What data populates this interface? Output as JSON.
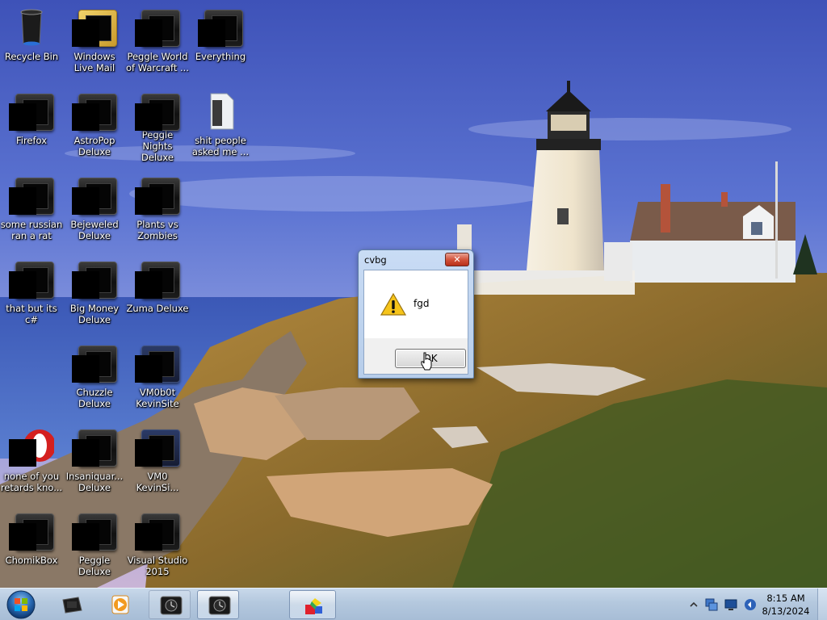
{
  "desktop": {
    "icons": [
      {
        "label": "Recycle Bin",
        "icon": "recycle-bin-icon"
      },
      {
        "label": "Windows Live Mail",
        "icon": "windows-live-mail-icon"
      },
      {
        "label": "Peggle World of Warcraft ...",
        "icon": "peggle-world-of-warcraft-icon"
      },
      {
        "label": "Everything",
        "icon": "everything-icon"
      },
      {
        "label": "Firefox",
        "icon": "firefox-icon"
      },
      {
        "label": "AstroPop Deluxe",
        "icon": "astropop-deluxe-icon"
      },
      {
        "label": "Peggle Nights Deluxe",
        "icon": "peggle-nights-deluxe-icon"
      },
      {
        "label": "shit people asked me ...",
        "icon": "file-icon"
      },
      {
        "label": "some russian ran a rat",
        "icon": "app-icon"
      },
      {
        "label": "Bejeweled Deluxe",
        "icon": "bejeweled-deluxe-icon"
      },
      {
        "label": "Plants vs Zombies",
        "icon": "plants-vs-zombies-icon"
      },
      {
        "label": "that but its c#",
        "icon": "app-icon"
      },
      {
        "label": "Big Money Deluxe",
        "icon": "big-money-deluxe-icon"
      },
      {
        "label": "Zuma Deluxe",
        "icon": "zuma-deluxe-icon"
      },
      {
        "label": "Chuzzle Deluxe",
        "icon": "chuzzle-deluxe-icon"
      },
      {
        "label": "VM0b0t KevinSite",
        "icon": "vm0b0t-icon"
      },
      {
        "label": "none of you retards kno...",
        "icon": "opera-icon"
      },
      {
        "label": "Insaniquar... Deluxe",
        "icon": "insaniquarium-deluxe-icon"
      },
      {
        "label": "VM0 KevinSi...",
        "icon": "vm0-icon"
      },
      {
        "label": "ChomikBox",
        "icon": "chomikbox-icon"
      },
      {
        "label": "Peggle Deluxe",
        "icon": "peggle-deluxe-icon"
      },
      {
        "label": "Visual Studio 2015",
        "icon": "visual-studio-icon"
      }
    ]
  },
  "dialog": {
    "title": "cvbg",
    "close_symbol": "✕",
    "message": "fgd",
    "icon": "warning-icon",
    "ok_label": "OK"
  },
  "taskbar": {
    "start": "windows-start-icon",
    "pinned": [
      "camera-app-icon",
      "media-player-icon",
      "clock-app-icon",
      "clock-app-icon",
      "cube-app-icon"
    ],
    "tray_icons": [
      "show-hidden-icons-icon",
      "network-icon",
      "action-center-icon",
      "volume-icon"
    ],
    "time": "8:15 AM",
    "date": "8/13/2024"
  },
  "colors": {
    "sky": "#5a6fcf",
    "dialog_frame": "#c9dcf5",
    "close_red": "#d3543c",
    "taskbar": "#b4c8de"
  }
}
